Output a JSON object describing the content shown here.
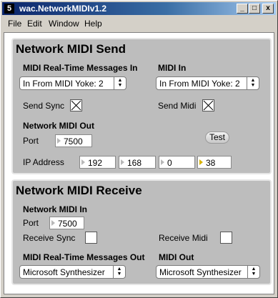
{
  "window": {
    "title": "wac.NetworkMIDIv1.2",
    "app_icon": "5"
  },
  "controls": {
    "minimize": "_",
    "maximize": "□",
    "close": "x"
  },
  "menu": [
    {
      "label": "File"
    },
    {
      "label": "Edit"
    },
    {
      "label": "Window"
    },
    {
      "label": "Help"
    }
  ],
  "send": {
    "title": "Network MIDI Send",
    "rt_in_label": "MIDI Real-Time Messages In",
    "rt_in_value": "In From MIDI Yoke:  2",
    "midi_in_label": "MIDI In",
    "midi_in_value": "In From MIDI Yoke:  2",
    "send_sync_label": "Send Sync",
    "send_sync_checked": true,
    "send_midi_label": "Send Midi",
    "send_midi_checked": true,
    "out_label": "Network MIDI Out",
    "port_label": "Port",
    "port_value": "7500",
    "test_label": "Test",
    "ip_label": "IP Address",
    "ip": [
      "192",
      "168",
      "0",
      "38"
    ]
  },
  "receive": {
    "title": "Network MIDI Receive",
    "in_label": "Network MIDI In",
    "port_label": "Port",
    "port_value": "7500",
    "receive_sync_label": "Receive Sync",
    "receive_sync_checked": false,
    "receive_midi_label": "Receive Midi",
    "receive_midi_checked": false,
    "rt_out_label": "MIDI Real-Time Messages Out",
    "rt_out_value": "Microsoft Synthesizer",
    "midi_out_label": "MIDI Out",
    "midi_out_value": "Microsoft Synthesizer"
  }
}
